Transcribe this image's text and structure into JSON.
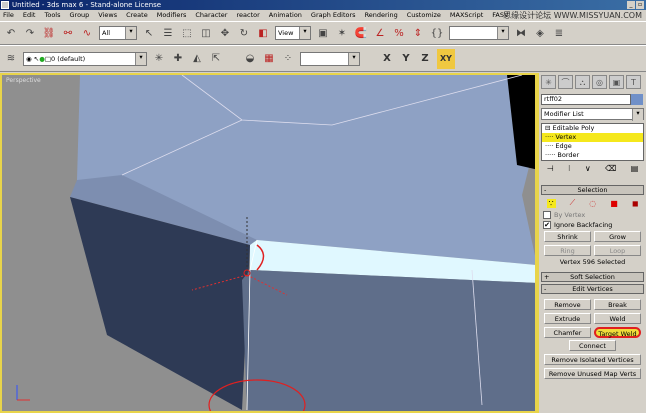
{
  "title": "Untitled - 3ds max 6 - Stand-alone License",
  "window_buttons": [
    "_",
    "▫"
  ],
  "watermark": "思缘设计论坛 WWW.MISSYUAN.COM",
  "menu": [
    "File",
    "Edit",
    "Tools",
    "Group",
    "Views",
    "Create",
    "Modifiers",
    "Character",
    "reactor",
    "Animation",
    "Graph Editors",
    "Rendering",
    "Customize",
    "MAXScript",
    "FASV"
  ],
  "toolbar1": {
    "selection_filter": "All",
    "ref_coord": "View"
  },
  "toolbar2": {
    "layer": "0 (default)",
    "axes": [
      "X",
      "Y",
      "Z",
      "XY"
    ],
    "active_axis": "XY"
  },
  "viewport": {
    "label": "Perspective"
  },
  "command_panel": {
    "object_name": "rtff02",
    "modifier_list": "Modifier List",
    "stack": [
      "⊟ Editable Poly",
      "···· Vertex",
      "···· Edge",
      "····· Border"
    ],
    "selected_stack_item": 1,
    "selection_rollout": "Selection",
    "by_vertex": "By Vertex",
    "ignore_backfacing": "Ignore Backfacing",
    "shrink": "Shrink",
    "grow": "Grow",
    "ring": "Ring",
    "loop": "Loop",
    "status": "Vertex 596 Selected",
    "soft_selection": "Soft Selection",
    "edit_vertices": "Edit Vertices",
    "remove": "Remove",
    "break": "Break",
    "extrude": "Extrude",
    "weld": "Weld",
    "chamfer": "Chamfer",
    "target_weld": "Target Weld",
    "connect": "Connect",
    "remove_isolated": "Remove Isolated Vertices",
    "remove_unused": "Remove Unused Map Verts"
  },
  "colors": {
    "accent": "#f0dc3a",
    "viewport_border": "#e8d44a",
    "highlight_circle": "#e02020"
  }
}
